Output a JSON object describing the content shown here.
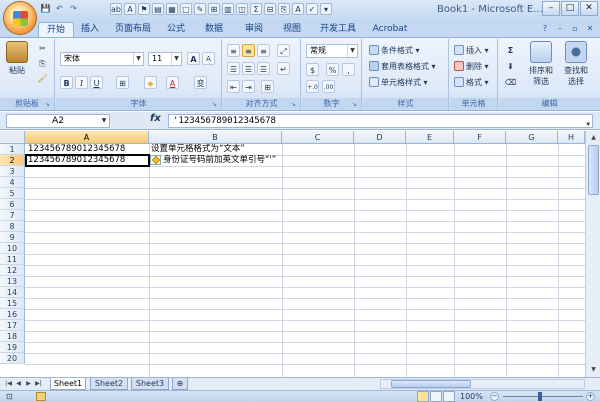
{
  "window": {
    "title": "Book1 - Microsoft E...",
    "minimize": "–",
    "maximize": "□",
    "close": "✕"
  },
  "quick_access": [
    "💾",
    "↶",
    "↷"
  ],
  "title_toolbar_icons": [
    "ab",
    "A",
    "⚑",
    "▤",
    "▦",
    "□",
    "✎",
    "⊞",
    "▥",
    "◫",
    "Σ",
    "⊟",
    "⎘",
    "A",
    "✓",
    "▾"
  ],
  "tabs": [
    {
      "label": "开始",
      "active": true
    },
    {
      "label": "插入"
    },
    {
      "label": "页面布局"
    },
    {
      "label": "公式"
    },
    {
      "label": "数据"
    },
    {
      "label": "审阅"
    },
    {
      "label": "视图"
    },
    {
      "label": "开发工具"
    },
    {
      "label": "Acrobat"
    }
  ],
  "ribbon": {
    "clipboard": {
      "label": "剪贴板",
      "paste": "粘贴",
      "cut_icon": "scissors-icon",
      "copy_icon": "copy-icon",
      "format_painter_icon": "brush-icon"
    },
    "font": {
      "label": "字体",
      "font_name": "宋体",
      "font_size": "11",
      "grow": "A",
      "shrink": "A",
      "bold": "B",
      "italic": "I",
      "underline": "U",
      "border": "⊞",
      "fill": "◈",
      "color": "A",
      "phonetic": "变"
    },
    "alignment": {
      "label": "对齐方式"
    },
    "number": {
      "label": "数字",
      "format": "常规",
      "currency": "$",
      "percent": "%",
      "comma": ",",
      "inc_decimal": "+.0",
      "dec_decimal": ".00"
    },
    "styles": {
      "label": "样式",
      "conditional": "条件格式",
      "table": "套用表格格式",
      "cell": "单元格样式"
    },
    "cells": {
      "label": "单元格",
      "insert": "插入",
      "delete": "删除",
      "format": "格式"
    },
    "editing": {
      "label": "编辑",
      "sum": "Σ",
      "sort_filter_line1": "排序和",
      "sort_filter_line2": "筛选",
      "find_select_line1": "查找和",
      "find_select_line2": "选择"
    }
  },
  "formula_bar": {
    "name_box": "A2",
    "fx": "fx",
    "formula": "'123456789012345678"
  },
  "columns": [
    "A",
    "B",
    "C",
    "D",
    "E",
    "F",
    "G",
    "H"
  ],
  "rows": [
    "1",
    "2",
    "3",
    "4",
    "5",
    "6",
    "7",
    "8",
    "9",
    "10",
    "11",
    "12",
    "13",
    "14",
    "15",
    "16",
    "17",
    "18",
    "19",
    "20"
  ],
  "cells": {
    "A1": "123456789012345678",
    "B1": "设置单元格格式为“文本”",
    "A2": "123456789012345678",
    "B2": "身份证号码前加英文单引号“'”"
  },
  "sheets": [
    {
      "label": "Sheet1",
      "active": true
    },
    {
      "label": "Sheet2"
    },
    {
      "label": "Sheet3"
    }
  ],
  "status": {
    "zoom": "100%",
    "zoom_minus": "−",
    "zoom_plus": "+"
  }
}
